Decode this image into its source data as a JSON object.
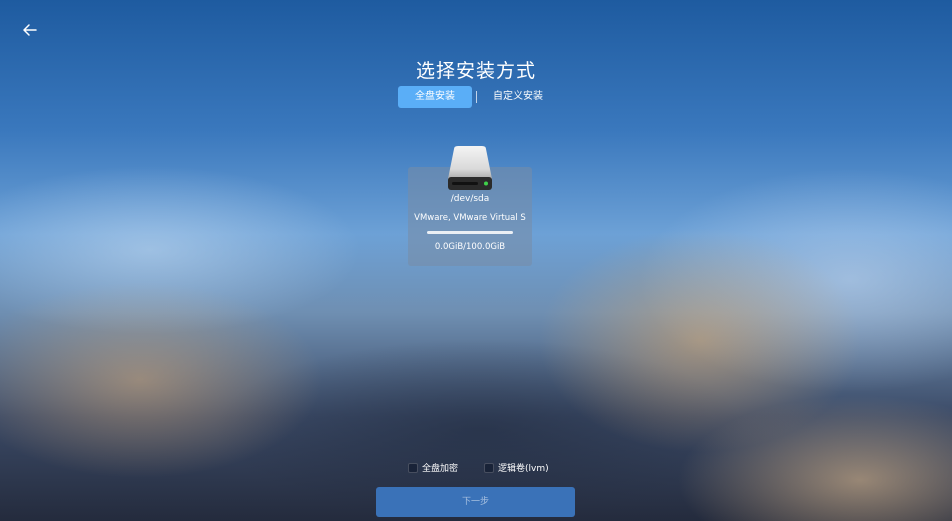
{
  "header": {
    "title": "选择安装方式",
    "back_icon": "arrow-left-icon"
  },
  "tabs": [
    {
      "label": "全盘安装",
      "active": true
    },
    {
      "label": "自定义安装",
      "active": false
    }
  ],
  "disk": {
    "icon": "hard-drive-icon",
    "device": "/dev/sda",
    "model": "VMware, VMware Virtual S",
    "usage_fraction": 0,
    "size_text": "0.0GiB/100.0GiB"
  },
  "options": [
    {
      "label": "全盘加密",
      "checked": false
    },
    {
      "label": "逻辑卷(lvm)",
      "checked": false
    }
  ],
  "footer": {
    "next_label": "下一步"
  },
  "colors": {
    "accent": "#5aaef7",
    "button": "#3a72b8"
  }
}
